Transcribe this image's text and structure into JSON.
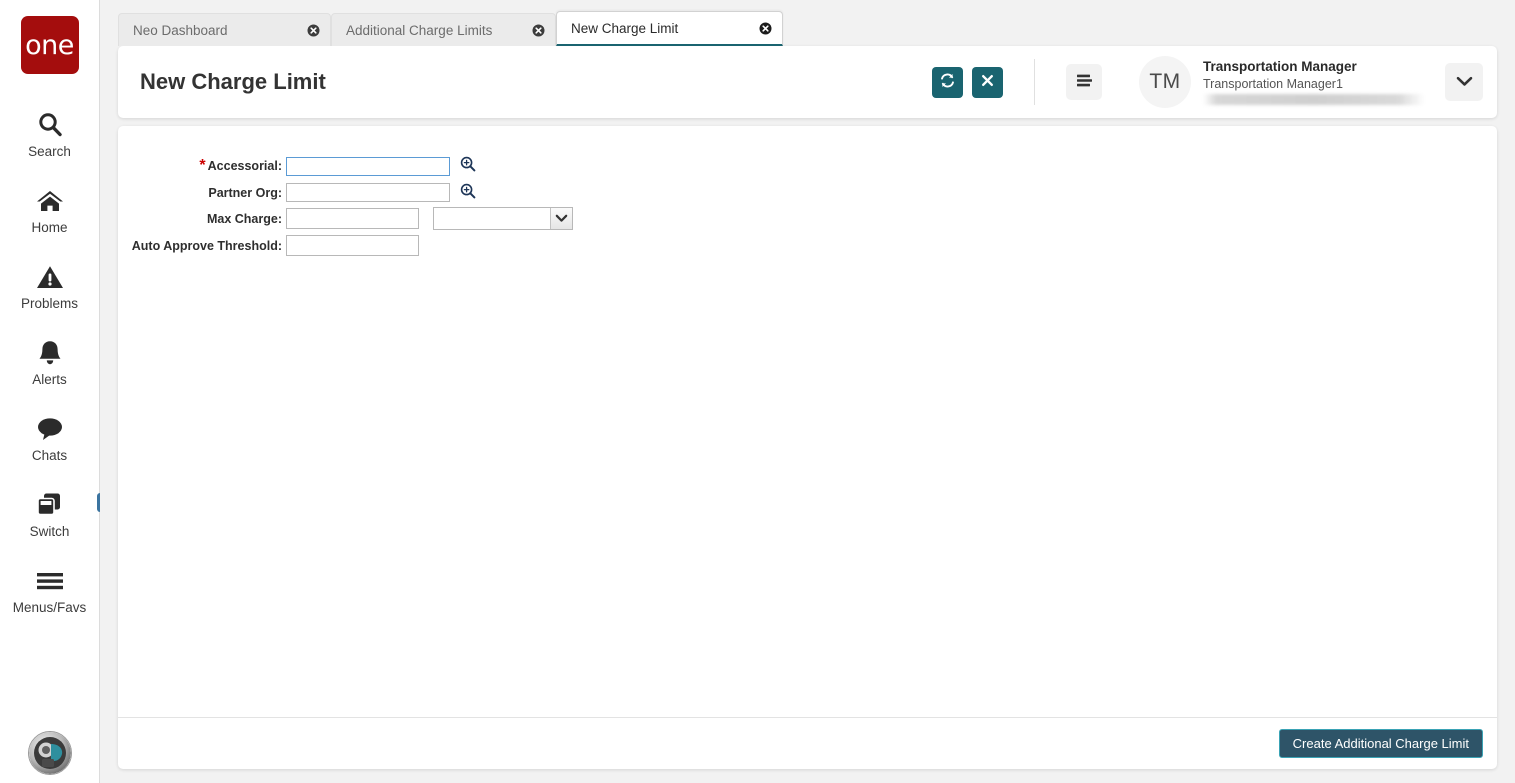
{
  "brand": {
    "logo_text": "one",
    "logo_color": "#a40d0d"
  },
  "theme": {
    "accent_teal": "#1a6470",
    "primary_button_bg": "#2e5468",
    "primary_button_border": "#3aa3b5",
    "active_tab_underline": "#1a6470",
    "required_star": "#cc0000",
    "focus_border": "#5b9bd5",
    "switch_badge": "#3b74a0"
  },
  "sidebar": {
    "items": [
      {
        "label": "Search",
        "icon": "search-icon"
      },
      {
        "label": "Home",
        "icon": "home-icon"
      },
      {
        "label": "Problems",
        "icon": "warning-triangle-icon"
      },
      {
        "label": "Alerts",
        "icon": "bell-icon"
      },
      {
        "label": "Chats",
        "icon": "chat-bubble-icon"
      },
      {
        "label": "Switch",
        "icon": "windows-stack-icon",
        "badge_icon": "exchange-arrows-icon"
      },
      {
        "label": "Menus/Favs",
        "icon": "hamburger-icon"
      }
    ],
    "bottom_avatar_icon": "assistant-avatar-icon"
  },
  "tabs": [
    {
      "label": "Neo Dashboard",
      "active": false,
      "close_icon": "close-circle-icon"
    },
    {
      "label": "Additional Charge Limits",
      "active": false,
      "close_icon": "close-circle-icon"
    },
    {
      "label": "New Charge Limit",
      "active": true,
      "close_icon": "close-circle-icon"
    }
  ],
  "header": {
    "title": "New Charge Limit",
    "refresh_icon": "refresh-icon",
    "close_icon": "close-x-icon",
    "menu_icon": "hamburger-menu-icon",
    "avatar_initials": "TM",
    "user_name": "Transportation Manager",
    "user_subtitle": "Transportation Manager1",
    "user_redacted": "",
    "chevron_icon": "chevron-down-icon"
  },
  "form": {
    "fields": [
      {
        "label": "Accessorial:",
        "required": true,
        "value": "",
        "placeholder": "",
        "focused": true,
        "lookup_icon": "magnifier-plus-icon"
      },
      {
        "label": "Partner Org:",
        "required": false,
        "value": "",
        "placeholder": "",
        "focused": false,
        "lookup_icon": "magnifier-plus-icon"
      },
      {
        "label": "Max Charge:",
        "required": false,
        "value": "",
        "placeholder": "",
        "focused": false,
        "currency_value": "",
        "currency_chevron_icon": "chevron-down-icon"
      },
      {
        "label": "Auto Approve Threshold:",
        "required": false,
        "value": "",
        "placeholder": "",
        "focused": false
      }
    ]
  },
  "footer": {
    "create_label": "Create Additional Charge Limit"
  }
}
